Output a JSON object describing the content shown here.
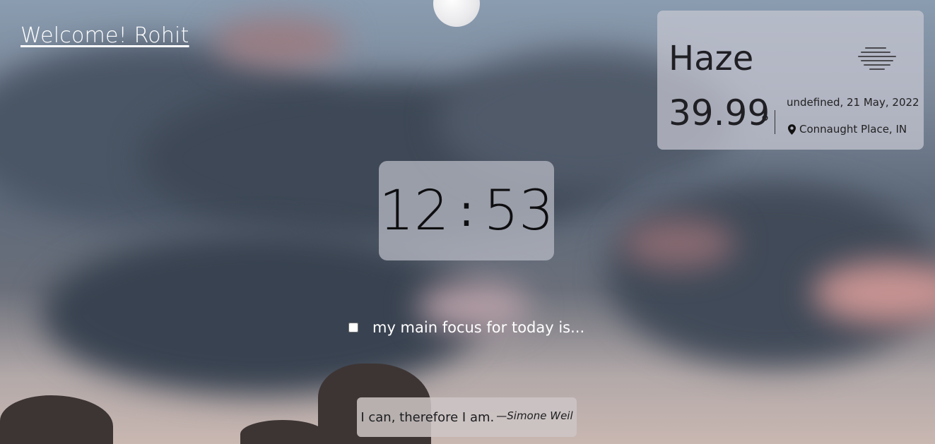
{
  "welcome": {
    "text": "Welcome! Rohit"
  },
  "weather": {
    "condition": "Haze",
    "icon": "haze-icon",
    "temperature": "39.99",
    "degree_symbol": "°",
    "date": "undefined, 21 May, 2022",
    "location_icon": "map-pin-icon",
    "location": "Connaught Place, IN"
  },
  "clock": {
    "hours": "12",
    "separator": ":",
    "minutes": "53"
  },
  "focus": {
    "text": "my main focus for today is..."
  },
  "quote": {
    "text": "I can, therefore I am.",
    "author": "—Simone Weil"
  }
}
